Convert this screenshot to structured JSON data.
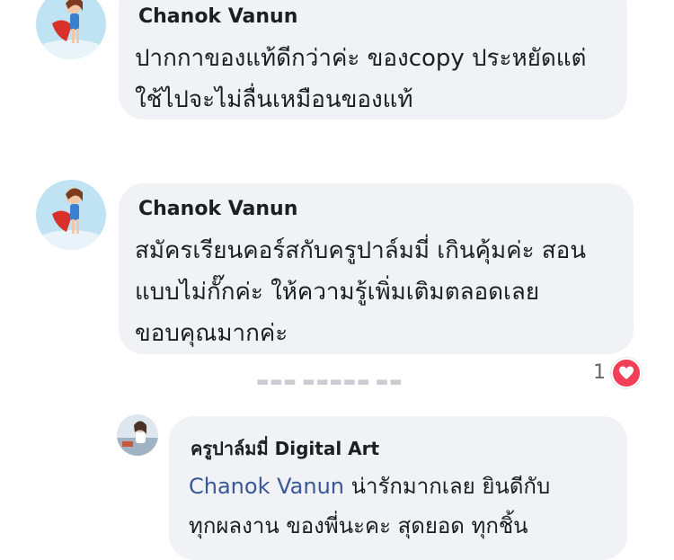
{
  "comments": [
    {
      "author": "Chanok Vanun",
      "lines": [
        "ปากกาของแท้ดีกว่าค่ะ  ของcopy ประหยัดแต่",
        "ใช้ไปจะไม่ลื่นเหมือนของแท้"
      ]
    },
    {
      "author": "Chanok Vanun",
      "lines": [
        "สมัครเรียนคอร์สกับครูปาล์มมี่  เกินคุ้มค่ะ สอน",
        "แบบไม่กั๊กค่ะ  ให้ความรู้เพิ่มเติมตลอดเลย",
        "ขอบคุณมากค่ะ"
      ],
      "reaction_count": "1"
    }
  ],
  "reply": {
    "author": "ครูปาล์มมี่  Digital Art",
    "mention": "Chanok Vanun",
    "line1_rest": " น่ารักมากเลย   ยินดีกับ",
    "line2": "ทุกผลงาน ของพี่นะคะ   สุดยอด  ทุกชิ้น"
  },
  "colors": {
    "bubble": "#f0f2f5",
    "mention": "#385898",
    "heart": "#f33e58"
  },
  "icons": {
    "reaction": "heart-icon"
  }
}
